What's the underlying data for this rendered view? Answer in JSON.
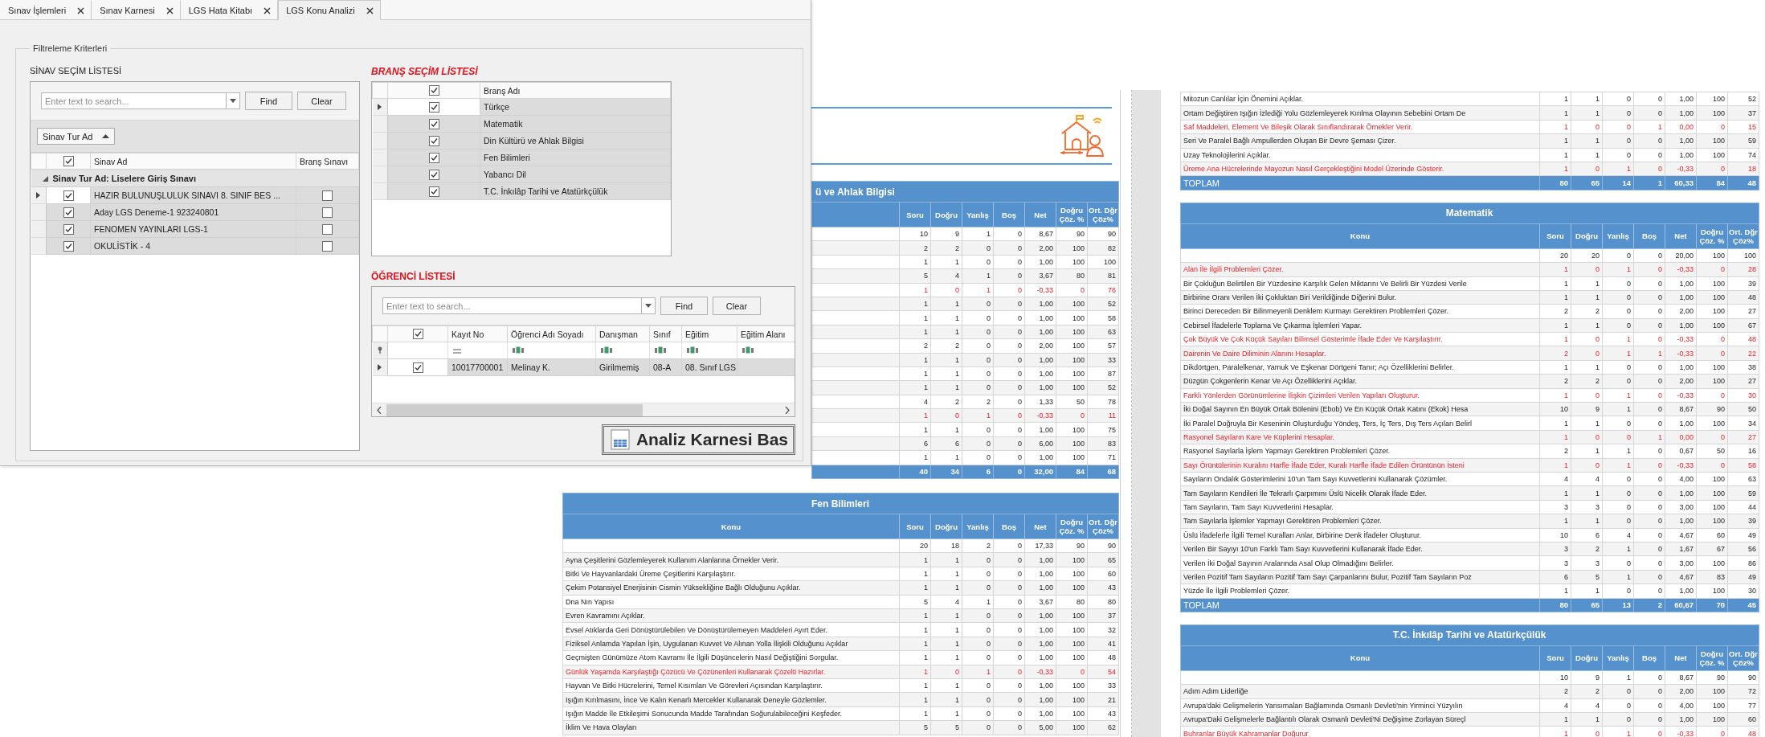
{
  "dialog": {
    "tabs": [
      {
        "label": "Sınav İşlemleri",
        "selected": false
      },
      {
        "label": "Sınav Karnesi",
        "selected": false
      },
      {
        "label": "LGS Hata Kitabı",
        "selected": false
      },
      {
        "label": "LGS Konu Analizi",
        "selected": true
      }
    ],
    "filter_group": {
      "title": "Filtreleme Kriterleri"
    },
    "exam_list": {
      "title": "SİNAV SEÇİM LİSTESİ",
      "search_placeholder": "Enter text to search...",
      "find_label": "Find",
      "clear_label": "Clear",
      "group_by": "Sinav Tur Ad",
      "all_checked": true,
      "columns": [
        "Sinav Ad",
        "Branş Sınavı"
      ],
      "group": {
        "label": "Sinav Tur Ad: Liselere Giriş Sınavı",
        "expanded": true
      },
      "rows": [
        {
          "name": "HAZIR BULUNUŞLULUK SINAVI 8. SINIF BES ...",
          "checked": true,
          "branch_exam": false,
          "focused": true
        },
        {
          "name": "Aday  LGS Deneme-1 923240801",
          "checked": true,
          "branch_exam": false,
          "focused": false
        },
        {
          "name": "FENOMEN YAYINLARI LGS-1",
          "checked": true,
          "branch_exam": false,
          "focused": false
        },
        {
          "name": "OKULİSTİK - 4",
          "checked": true,
          "branch_exam": false,
          "focused": false
        }
      ]
    },
    "branch_list": {
      "title": "BRANŞ SEÇİM LİSTESİ",
      "all_checked": true,
      "column": "Branş Adı",
      "rows": [
        {
          "name": "Türkçe",
          "checked": true,
          "focused": true
        },
        {
          "name": "Matematik",
          "checked": true,
          "focused": false
        },
        {
          "name": "Din Kültürü ve Ahlak Bilgisi",
          "checked": true,
          "focused": false
        },
        {
          "name": "Fen Bilimleri",
          "checked": true,
          "focused": false
        },
        {
          "name": "Yabancı Dil",
          "checked": true,
          "focused": false
        },
        {
          "name": "T.C. İnkılâp Tarihi ve Atatürkçülük",
          "checked": true,
          "focused": false
        }
      ]
    },
    "student_list": {
      "title": "ÖĞRENCİ LİSTESİ",
      "search_placeholder": "Enter text to search...",
      "find_label": "Find",
      "clear_label": "Clear",
      "all_checked": true,
      "columns": [
        {
          "label": "Kayıt No",
          "kind": "equals"
        },
        {
          "label": "Öğrenci Adı Soyadı",
          "kind": "text"
        },
        {
          "label": "Danışman",
          "kind": "text"
        },
        {
          "label": "Sınıf",
          "kind": "text"
        },
        {
          "label": "Eğitim",
          "kind": "text"
        },
        {
          "label": "Eğitim Alanı",
          "kind": "text"
        }
      ],
      "rows": [
        {
          "checked": true,
          "focused": true,
          "cells": [
            "10017700001",
            "Melinay K.",
            "Girilmemiş",
            "08-A",
            "08. Sınıf LGS"
          ]
        }
      ]
    },
    "print_button": "Analiz Karnesi Bas"
  },
  "report": {
    "pages": [
      {
        "tables": [
          {
            "kind": "cut",
            "title": "ü ve Ahlak Bilgisi",
            "columns": [
              "Soru",
              "Doğru",
              "Yanlış",
              "Boş",
              "Net",
              "Doğru Çöz. %",
              "Ort. Dğr Çöz%"
            ],
            "rows": [
              {
                "values": [
                  "10",
                  "9",
                  "1",
                  "0",
                  "8,67",
                  "90",
                  "90"
                ],
                "highlighted": false
              },
              {
                "values": [
                  "2",
                  "2",
                  "0",
                  "0",
                  "2,00",
                  "100",
                  "82"
                ],
                "highlighted": false
              },
              {
                "values": [
                  "1",
                  "1",
                  "0",
                  "0",
                  "1,00",
                  "100",
                  "100"
                ],
                "highlighted": false
              },
              {
                "values": [
                  "5",
                  "4",
                  "1",
                  "0",
                  "3,67",
                  "80",
                  "81"
                ],
                "highlighted": false
              },
              {
                "values": [
                  "1",
                  "0",
                  "1",
                  "0",
                  "-0,33",
                  "0",
                  "76"
                ],
                "highlighted": true
              },
              {
                "values": [
                  "1",
                  "1",
                  "0",
                  "0",
                  "1,00",
                  "100",
                  "52"
                ],
                "highlighted": false
              },
              {
                "values": [
                  "1",
                  "1",
                  "0",
                  "0",
                  "1,00",
                  "100",
                  "58"
                ],
                "highlighted": false
              },
              {
                "values": [
                  "1",
                  "1",
                  "0",
                  "0",
                  "1,00",
                  "100",
                  "63"
                ],
                "highlighted": false
              },
              {
                "values": [
                  "2",
                  "2",
                  "0",
                  "0",
                  "2,00",
                  "100",
                  "57"
                ],
                "highlighted": false
              },
              {
                "values": [
                  "1",
                  "1",
                  "0",
                  "0",
                  "1,00",
                  "100",
                  "33"
                ],
                "highlighted": false
              },
              {
                "values": [
                  "1",
                  "1",
                  "0",
                  "0",
                  "1,00",
                  "100",
                  "87"
                ],
                "highlighted": false
              },
              {
                "values": [
                  "1",
                  "1",
                  "0",
                  "0",
                  "1,00",
                  "100",
                  "52"
                ],
                "highlighted": false
              },
              {
                "values": [
                  "4",
                  "2",
                  "2",
                  "0",
                  "1,33",
                  "50",
                  "78"
                ],
                "highlighted": false
              },
              {
                "values": [
                  "1",
                  "0",
                  "1",
                  "0",
                  "-0,33",
                  "0",
                  "11"
                ],
                "highlighted": true
              },
              {
                "values": [
                  "1",
                  "1",
                  "0",
                  "0",
                  "1,00",
                  "100",
                  "75"
                ],
                "highlighted": false
              },
              {
                "values": [
                  "6",
                  "6",
                  "0",
                  "0",
                  "6,00",
                  "100",
                  "83"
                ],
                "highlighted": false
              },
              {
                "values": [
                  "1",
                  "1",
                  "0",
                  "0",
                  "1,00",
                  "100",
                  "71"
                ],
                "highlighted": false
              }
            ],
            "total": {
              "values": [
                "40",
                "34",
                "6",
                "0",
                "32,00",
                "84",
                "68"
              ]
            }
          },
          {
            "kind": "full",
            "title": "Fen Bilimleri",
            "columns": [
              "Konu",
              "Soru",
              "Doğru",
              "Yanlış",
              "Boş",
              "Net",
              "Doğru Çöz. %",
              "Ort. Dğr Çöz%"
            ],
            "rows": [
              {
                "values": [
                  "20",
                  "18",
                  "2",
                  "0",
                  "17,33",
                  "90",
                  "90"
                ],
                "highlighted": false
              },
              {
                "topic": "Ayna Çeşitlerini Gözlemleyerek Kullanım Alanlarına Örnekler Verir.",
                "values": [
                  "1",
                  "1",
                  "0",
                  "0",
                  "1,00",
                  "100",
                  "65"
                ],
                "highlighted": false
              },
              {
                "topic": "Bitki Ve Hayvanlardaki Üreme Çeşitlerini Karşılaştırır.",
                "values": [
                  "1",
                  "1",
                  "0",
                  "0",
                  "1,00",
                  "100",
                  "60"
                ],
                "highlighted": false
              },
              {
                "topic": "Çekim Potansiyel Enerjisinin Cismin Yüksekliğine Bağlı Olduğunu Açıklar.",
                "values": [
                  "1",
                  "1",
                  "0",
                  "0",
                  "1,00",
                  "100",
                  "43"
                ],
                "highlighted": false
              },
              {
                "topic": "Dna Nın Yapısı",
                "values": [
                  "5",
                  "4",
                  "1",
                  "0",
                  "3,67",
                  "80",
                  "80"
                ],
                "highlighted": false
              },
              {
                "topic": "Evren Kavramını Açıklar.",
                "values": [
                  "1",
                  "1",
                  "0",
                  "0",
                  "1,00",
                  "100",
                  "37"
                ],
                "highlighted": false
              },
              {
                "topic": "Evsel Atıklarda Geri Dönüştürülebilen Ve Dönüştürülemeyen Maddeleri Ayırt Eder.",
                "values": [
                  "1",
                  "1",
                  "0",
                  "0",
                  "1,00",
                  "100",
                  "32"
                ],
                "highlighted": false
              },
              {
                "topic": "Fiziksel Anlamda Yapılan İşin, Uygulanan Kuvvet Ve Alınan Yolla İlişkili Olduğunu Açıklar",
                "values": [
                  "1",
                  "1",
                  "0",
                  "0",
                  "1,00",
                  "100",
                  "41"
                ],
                "highlighted": false
              },
              {
                "topic": "Geçmişten Günümüze Atom Kavramı İle İlgili Düşüncelerin Nasıl Değiştiğini Sorgular.",
                "values": [
                  "1",
                  "1",
                  "0",
                  "0",
                  "1,00",
                  "100",
                  "48"
                ],
                "highlighted": false
              },
              {
                "topic": "Günlük Yaşamda Karşılaştığı Çözücü Ve Çözünenleri Kullanarak Çözelti Hazırlar.",
                "values": [
                  "1",
                  "0",
                  "1",
                  "0",
                  "-0,33",
                  "0",
                  "54"
                ],
                "highlighted": true
              },
              {
                "topic": "Hayvan Ve Bitki Hücrelerini, Temel Kısımları Ve Görevleri Açısından Karşılaştırır.",
                "values": [
                  "1",
                  "1",
                  "0",
                  "0",
                  "1,00",
                  "100",
                  "33"
                ],
                "highlighted": false
              },
              {
                "topic": "Işığın Kırılmasını, İnce Ve Kalın Kenarlı Mercekler Kullanarak Deneyle Gözlemler.",
                "values": [
                  "1",
                  "1",
                  "0",
                  "0",
                  "1,00",
                  "100",
                  "21"
                ],
                "highlighted": false
              },
              {
                "topic": "Işığın Madde İle Etkileşimi Sonucunda Madde Tarafından Soğurulabileceğini Keşfeder.",
                "values": [
                  "1",
                  "1",
                  "0",
                  "0",
                  "1,00",
                  "100",
                  "43"
                ],
                "highlighted": false
              },
              {
                "topic": "İklim Ve Hava Olayları",
                "values": [
                  "5",
                  "5",
                  "0",
                  "0",
                  "5,00",
                  "100",
                  "62"
                ],
                "highlighted": false
              }
            ]
          }
        ]
      },
      {
        "tables": [
          {
            "kind": "continued",
            "rows": [
              {
                "topic": "Mitozun Canlılar İçin Önemini Açıklar.",
                "values": [
                  "1",
                  "1",
                  "0",
                  "0",
                  "1,00",
                  "100",
                  "52"
                ],
                "highlighted": false
              },
              {
                "topic": "Ortam Değiştiren Işığın İzlediği Yolu Gözlemleyerek Kırılma Olayının Sebebini Ortam De",
                "values": [
                  "1",
                  "1",
                  "0",
                  "0",
                  "1,00",
                  "100",
                  "37"
                ],
                "highlighted": false
              },
              {
                "topic": "Saf Maddeleri, Element Ve Bileşik Olarak Sınıflandırarak Örnekler Verir.",
                "values": [
                  "1",
                  "0",
                  "0",
                  "1",
                  "0,00",
                  "0",
                  "15"
                ],
                "highlighted": true
              },
              {
                "topic": "Seri Ve Paralel Bağlı Ampullerden Oluşan Bir Devre Şeması Çizer.",
                "values": [
                  "1",
                  "1",
                  "0",
                  "0",
                  "1,00",
                  "100",
                  "59"
                ],
                "highlighted": false
              },
              {
                "topic": "Uzay Teknolojilerini Açıklar.",
                "values": [
                  "1",
                  "1",
                  "0",
                  "0",
                  "1,00",
                  "100",
                  "74"
                ],
                "highlighted": false
              },
              {
                "topic": "Üreme Ana Hücrelerinde Mayozun Nasıl Gerçekleştiğini Model Üzerinde Gösterir.",
                "values": [
                  "1",
                  "0",
                  "1",
                  "0",
                  "-0,33",
                  "0",
                  "18"
                ],
                "highlighted": true
              }
            ],
            "total": {
              "label": "TOPLAM",
              "values": [
                "80",
                "65",
                "14",
                "1",
                "60,33",
                "84",
                "48"
              ]
            }
          },
          {
            "kind": "full",
            "title": "Matematik",
            "columns": [
              "Konu",
              "Soru",
              "Doğru",
              "Yanlış",
              "Boş",
              "Net",
              "Doğru Çöz. %",
              "Ort. Dğr Çöz%"
            ],
            "rows": [
              {
                "values": [
                  "20",
                  "20",
                  "0",
                  "0",
                  "20,00",
                  "100",
                  "100"
                ],
                "highlighted": false
              },
              {
                "topic": "Alan İle İlgili Problemleri Çözer.",
                "values": [
                  "1",
                  "0",
                  "1",
                  "0",
                  "-0,33",
                  "0",
                  "28"
                ],
                "highlighted": true
              },
              {
                "topic": "Bir Çokluğun Belirtilen Bir Yüzdesine Karşılık Gelen Miktarını Ve Belirli Bir Yüzdesi Verile",
                "values": [
                  "1",
                  "1",
                  "0",
                  "0",
                  "1,00",
                  "100",
                  "39"
                ],
                "highlighted": false
              },
              {
                "topic": "Birbirine Oranı Verilen İki Çokluktan Biri Verildiğinde Diğerini Bulur.",
                "values": [
                  "1",
                  "1",
                  "0",
                  "0",
                  "1,00",
                  "100",
                  "48"
                ],
                "highlighted": false
              },
              {
                "topic": "Birinci Dereceden Bir Bilinmeyenli Denklem Kurmayı Gerektiren Problemleri Çözer.",
                "values": [
                  "2",
                  "2",
                  "0",
                  "0",
                  "2,00",
                  "100",
                  "27"
                ],
                "highlighted": false
              },
              {
                "topic": "Cebirsel İfadelerle Toplama Ve Çıkarma İşlemleri Yapar.",
                "values": [
                  "1",
                  "1",
                  "0",
                  "0",
                  "1,00",
                  "100",
                  "67"
                ],
                "highlighted": false
              },
              {
                "topic": "Çok Büyük Ve Çok Küçük Sayıları Bilimsel Gösterimle İfade Eder Ve Karşılaştırır.",
                "values": [
                  "1",
                  "0",
                  "1",
                  "0",
                  "-0,33",
                  "0",
                  "48"
                ],
                "highlighted": true
              },
              {
                "topic": "Dairenin Ve Daire Diliminin Alanını Hesaplar.",
                "values": [
                  "2",
                  "0",
                  "1",
                  "1",
                  "-0,33",
                  "0",
                  "22"
                ],
                "highlighted": true
              },
              {
                "topic": "Dikdörtgen, Paralelkenar, Yamuk Ve Eşkenar Dörtgeni Tanır; Açı Özelliklerini Belirler.",
                "values": [
                  "1",
                  "1",
                  "0",
                  "0",
                  "1,00",
                  "100",
                  "38"
                ],
                "highlighted": false
              },
              {
                "topic": "Düzgün Çokgenlerin Kenar Ve Açı Özelliklerini Açıklar.",
                "values": [
                  "2",
                  "2",
                  "0",
                  "0",
                  "2,00",
                  "100",
                  "27"
                ],
                "highlighted": false
              },
              {
                "topic": "Farklı Yönlerden Görünümlerine İlişkin Çizimleri Verilen Yapıları Oluşturur.",
                "values": [
                  "1",
                  "0",
                  "1",
                  "0",
                  "-0,33",
                  "0",
                  "30"
                ],
                "highlighted": true
              },
              {
                "topic": "İki Doğal Sayının En Büyük Ortak Bölenini (Ebob) Ve En Küçük Ortak Katını (Ekok) Hesa",
                "values": [
                  "10",
                  "9",
                  "1",
                  "0",
                  "8,67",
                  "90",
                  "50"
                ],
                "highlighted": false
              },
              {
                "topic": "İki Paralel Doğruyla Bir Keseninin Oluşturduğu Yöndeş, Ters, İç Ters, Dış Ters Açıları Belirl",
                "values": [
                  "1",
                  "1",
                  "0",
                  "0",
                  "1,00",
                  "100",
                  "34"
                ],
                "highlighted": false
              },
              {
                "topic": "Rasyonel Sayıların Kare Ve Küplerini Hesaplar.",
                "values": [
                  "1",
                  "0",
                  "0",
                  "1",
                  "0,00",
                  "0",
                  "27"
                ],
                "highlighted": true
              },
              {
                "topic": "Rasyonel Sayılarla İşlem Yapmayı Gerektiren Problemleri Çözer.",
                "values": [
                  "2",
                  "1",
                  "1",
                  "0",
                  "0,67",
                  "50",
                  "16"
                ],
                "highlighted": false
              },
              {
                "topic": "Sayı Örüntülerinin Kuralını Harfle İfade Eder, Kuralı Harfle İfade Edilen Örüntünün İsteni",
                "values": [
                  "1",
                  "0",
                  "1",
                  "0",
                  "-0,33",
                  "0",
                  "58"
                ],
                "highlighted": true
              },
              {
                "topic": "Sayıların Ondalık Gösterimlerini 10'un Tam Sayı Kuvvetlerini Kullanarak Çözümler.",
                "values": [
                  "4",
                  "4",
                  "0",
                  "0",
                  "4,00",
                  "100",
                  "63"
                ],
                "highlighted": false
              },
              {
                "topic": "Tam Sayıların Kendileri İle Tekrarlı Çarpımını Üslü Nicelik Olarak İfade Eder.",
                "values": [
                  "1",
                  "1",
                  "0",
                  "0",
                  "1,00",
                  "100",
                  "59"
                ],
                "highlighted": false
              },
              {
                "topic": "Tam Sayıların, Tam Sayı Kuvvetlerini Hesaplar.",
                "values": [
                  "3",
                  "3",
                  "0",
                  "0",
                  "3,00",
                  "100",
                  "44"
                ],
                "highlighted": false
              },
              {
                "topic": "Tam Sayılarla İşlemler Yapmayı Gerektiren Problemleri Çözer.",
                "values": [
                  "1",
                  "1",
                  "0",
                  "0",
                  "1,00",
                  "100",
                  "39"
                ],
                "highlighted": false
              },
              {
                "topic": "Üslü İfadelerle İlgili Temel Kuralları Anlar, Birbirine Denk İfadeler Oluşturur.",
                "values": [
                  "10",
                  "6",
                  "4",
                  "0",
                  "4,67",
                  "60",
                  "49"
                ],
                "highlighted": false
              },
              {
                "topic": "Verilen Bir Sayıyı 10'un Farklı Tam Sayı Kuvvetlerini Kullanarak İfade Eder.",
                "values": [
                  "3",
                  "2",
                  "1",
                  "0",
                  "1,67",
                  "67",
                  "56"
                ],
                "highlighted": false
              },
              {
                "topic": "Verilen İki Doğal Sayının Aralarında Asal Olup Olmadığını Belirler.",
                "values": [
                  "3",
                  "3",
                  "0",
                  "0",
                  "3,00",
                  "100",
                  "86"
                ],
                "highlighted": false
              },
              {
                "topic": "Verilen Pozitif Tam Sayıların Pozitif Tam Sayı Çarpanlarını Bulur, Pozitif Tam Sayıların Poz",
                "values": [
                  "6",
                  "5",
                  "1",
                  "0",
                  "4,67",
                  "83",
                  "49"
                ],
                "highlighted": false
              },
              {
                "topic": "Yüzde İle İlgili Problemleri Çözer.",
                "values": [
                  "1",
                  "1",
                  "0",
                  "0",
                  "1,00",
                  "100",
                  "30"
                ],
                "highlighted": false
              }
            ],
            "total": {
              "label": "TOPLAM",
              "values": [
                "80",
                "65",
                "13",
                "2",
                "60,67",
                "70",
                "45"
              ]
            }
          },
          {
            "kind": "full",
            "title": "T.C. İnkılâp Tarihi ve Atatürkçülük",
            "columns": [
              "Konu",
              "Soru",
              "Doğru",
              "Yanlış",
              "Boş",
              "Net",
              "Doğru Çöz. %",
              "Ort. Dğr Çöz%"
            ],
            "rows": [
              {
                "values": [
                  "10",
                  "9",
                  "1",
                  "0",
                  "8,67",
                  "90",
                  "90"
                ],
                "highlighted": false
              },
              {
                "topic": "Adım Adım Liderliğe",
                "values": [
                  "2",
                  "2",
                  "0",
                  "0",
                  "2,00",
                  "100",
                  "72"
                ],
                "highlighted": false
              },
              {
                "topic": "Avrupa'daki Gelişmelerin Yansımaları Bağlamında Osmanlı Devleti'nin Yirminci Yüzyılın",
                "values": [
                  "4",
                  "4",
                  "0",
                  "0",
                  "4,00",
                  "100",
                  "77"
                ],
                "highlighted": false
              },
              {
                "topic": "Avrupa'Daki Gelişmelerle Bağlantılı Olarak Osmanlı Devleti'Ni Değişime Zorlayan Süreçl",
                "values": [
                  "1",
                  "1",
                  "0",
                  "0",
                  "1,00",
                  "100",
                  "60"
                ],
                "highlighted": false
              },
              {
                "topic": "Buhranlar Büyük Kahramanlar Doğurur",
                "values": [
                  "1",
                  "0",
                  "1",
                  "0",
                  "-0,33",
                  "0",
                  "48"
                ],
                "highlighted": true
              }
            ]
          }
        ]
      }
    ]
  }
}
